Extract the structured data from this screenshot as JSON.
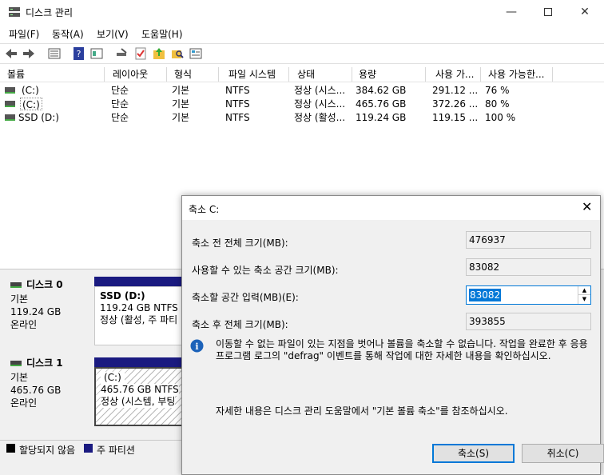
{
  "window": {
    "title": "디스크 관리"
  },
  "menu": [
    "파일(F)",
    "동작(A)",
    "보기(V)",
    "도움말(H)"
  ],
  "toolbar_icons": [
    "back-arrow-icon",
    "forward-arrow-icon",
    "list-view-icon",
    "help-icon",
    "properties-icon",
    "connect-icon",
    "check-icon",
    "folder-up-icon",
    "folder-search-icon",
    "settings-panel-icon"
  ],
  "columns": [
    "볼륨",
    "레이아웃",
    "형식",
    "파일 시스템",
    "상태",
    "용량",
    "사용 가...",
    "사용 가능한..."
  ],
  "volumes": [
    {
      "name": "(C:)",
      "layout": "단순",
      "type": "기본",
      "fs": "NTFS",
      "status": "정상 (시스...",
      "capacity": "384.62 GB",
      "free": "291.12 ...",
      "pct": "76 %"
    },
    {
      "name": "(C:)",
      "layout": "단순",
      "type": "기본",
      "fs": "NTFS",
      "status": "정상 (시스...",
      "capacity": "465.76 GB",
      "free": "372.26 ...",
      "pct": "80 %"
    },
    {
      "name": "SSD (D:)",
      "layout": "단순",
      "type": "기본",
      "fs": "NTFS",
      "status": "정상 (활성...",
      "capacity": "119.24 GB",
      "free": "119.15 ...",
      "pct": "100 %"
    }
  ],
  "disks": [
    {
      "name": "디스크 0",
      "type": "기본",
      "size": "119.24 GB",
      "state": "온라인",
      "partition": {
        "name": "SSD  (D:)",
        "size": "119.24 GB NTFS",
        "status": "정상 (활성, 주 파티"
      }
    },
    {
      "name": "디스크 1",
      "type": "기본",
      "size": "465.76 GB",
      "state": "온라인",
      "partition": {
        "name": "(C:)",
        "size": "465.76 GB NTFS",
        "status": "정상 (시스템, 부팅"
      }
    }
  ],
  "legend": {
    "unallocated": "할당되지 않음",
    "primary": "주 파티션"
  },
  "dialog": {
    "title": "축소 C:",
    "total_before_label": "축소 전 전체 크기(MB):",
    "total_before_value": "476937",
    "available_label": "사용할 수 있는 축소 공간 크기(MB):",
    "available_value": "83082",
    "enter_label": "축소할 공간 입력(MB)(E):",
    "enter_value": "83082",
    "total_after_label": "축소 후 전체 크기(MB):",
    "total_after_value": "393855",
    "info_text": "이동할 수 없는 파일이 있는 지점을 벗어나 볼륨을 축소할 수 없습니다. 작업을 완료한 후 응용 프로그램 로그의 \"defrag\" 이벤트를 통해 작업에 대한 자세한 내용을 확인하십시오.",
    "help_text": "자세한 내용은 디스크 관리 도움말에서 \"기본 볼륨 축소\"를 참조하십시오.",
    "shrink_button": "축소(S)",
    "cancel_button": "취소(C)"
  },
  "colors": {
    "primary_partition": "#1a1a80",
    "accent": "#0078d7"
  }
}
